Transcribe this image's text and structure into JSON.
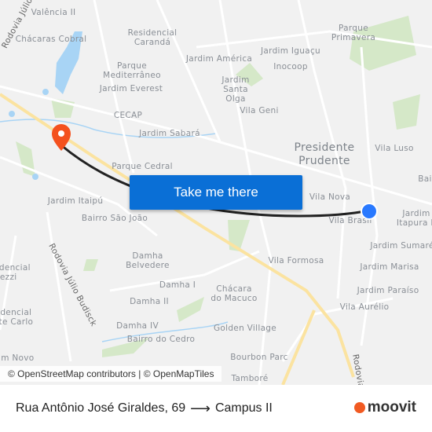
{
  "map": {
    "labels": [
      "Valência II",
      "Chácaras Cobral",
      "Residencial Carandá",
      "Parque Mediterrâneo",
      "Jardim Everest",
      "Jardim América",
      "Jardim Iguaçu",
      "Inocoop",
      "Jardim Santa Olga",
      "Parque Primavera",
      "CECAP",
      "Vila Geni",
      "Jardim Sabará",
      "Parque Cedral",
      "Vila Luso",
      "Jardim Itaipú",
      "Bairro São João",
      "Vila Nova",
      "Vila Brasil",
      "Jardim Itapura II",
      "Jardim Sumaré",
      "Vila Formosa",
      "Jardim Marisa",
      "Damha Belvedere",
      "Damha I",
      "Damha II",
      "Chácara do Macuco",
      "Jardim Paraíso",
      "Vila Aurélio",
      "Damha IV",
      "Bairro do Cedro",
      "Golden Village",
      "Bourbon Parc",
      "Residencial Mezzi",
      "Residencial Monte Carlo",
      "Jardim Novo",
      "Bai",
      "Rodovia Júlio Budisck",
      "Rodovia Júlio Budisck",
      "Rodovia",
      "Tamboré"
    ],
    "city": "Presidente Prudente",
    "colors": {
      "route": "#222222",
      "origin": "#2979ff",
      "destination": "#f4511e",
      "highway": "#fbe7a1",
      "water": "#a8d4f5",
      "park": "#cde3bf",
      "button": "#0a6fd6"
    },
    "origin_icon": "current-location-dot-icon",
    "destination_icon": "map-pin-icon"
  },
  "cta": {
    "label": "Take me there"
  },
  "attribution": "© OpenStreetMap contributors | © OpenMapTiles",
  "footer": {
    "from": "Rua Antônio José Giraldes, 69",
    "arrow": "⟶",
    "to": "Campus II"
  },
  "brand": {
    "name": "moovit"
  }
}
